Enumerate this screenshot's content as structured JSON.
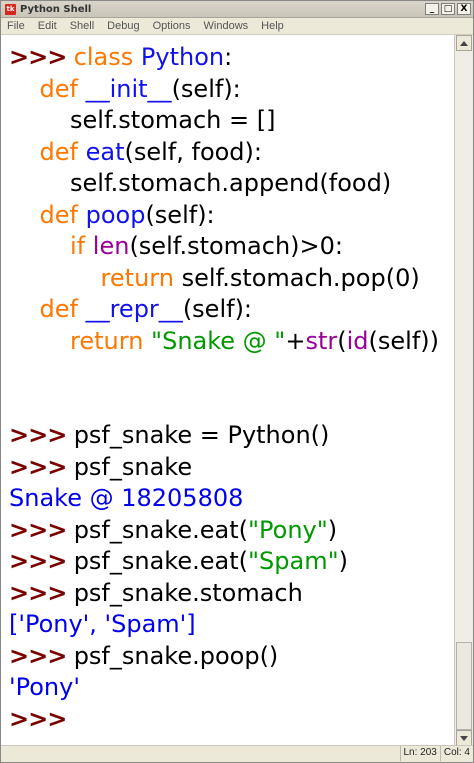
{
  "window": {
    "title": "Python Shell",
    "icon": "tk-feather-icon"
  },
  "menu": [
    "File",
    "Edit",
    "Shell",
    "Debug",
    "Options",
    "Windows",
    "Help"
  ],
  "controls": {
    "minimize": "_",
    "maximize": "□",
    "close": "X"
  },
  "colors": {
    "prompt": "#7a0000",
    "keyword": "#ff7700",
    "definition": "#1111ee",
    "builtin": "#990099",
    "string": "#009900",
    "output": "#0000ee"
  },
  "code": [
    [
      {
        "t": ">>> ",
        "c": "prompt"
      },
      {
        "t": "class ",
        "c": "kw"
      },
      {
        "t": "Python",
        "c": "fn"
      },
      {
        "t": ":",
        "c": "plain"
      }
    ],
    [
      {
        "t": "    ",
        "c": "plain"
      },
      {
        "t": "def ",
        "c": "kw"
      },
      {
        "t": "__init__",
        "c": "fn"
      },
      {
        "t": "(self):",
        "c": "plain"
      }
    ],
    [
      {
        "t": "        self.stomach = []",
        "c": "plain"
      }
    ],
    [
      {
        "t": "    ",
        "c": "plain"
      },
      {
        "t": "def ",
        "c": "kw"
      },
      {
        "t": "eat",
        "c": "fn"
      },
      {
        "t": "(self, food):",
        "c": "plain"
      }
    ],
    [
      {
        "t": "        self.stomach.append(food)",
        "c": "plain"
      }
    ],
    [
      {
        "t": "    ",
        "c": "plain"
      },
      {
        "t": "def ",
        "c": "kw"
      },
      {
        "t": "poop",
        "c": "fn"
      },
      {
        "t": "(self):",
        "c": "plain"
      }
    ],
    [
      {
        "t": "        ",
        "c": "plain"
      },
      {
        "t": "if ",
        "c": "kw"
      },
      {
        "t": "len",
        "c": "bi"
      },
      {
        "t": "(self.stomach)>0:",
        "c": "plain"
      }
    ],
    [
      {
        "t": "            ",
        "c": "plain"
      },
      {
        "t": "return ",
        "c": "kw"
      },
      {
        "t": "self.stomach.pop(0)",
        "c": "plain"
      }
    ],
    [
      {
        "t": "    ",
        "c": "plain"
      },
      {
        "t": "def ",
        "c": "kw"
      },
      {
        "t": "__repr__",
        "c": "fn"
      },
      {
        "t": "(self):",
        "c": "plain"
      }
    ],
    [
      {
        "t": "        ",
        "c": "plain"
      },
      {
        "t": "return ",
        "c": "kw"
      },
      {
        "t": "\"Snake @ \"",
        "c": "str"
      },
      {
        "t": "+",
        "c": "plain"
      },
      {
        "t": "str",
        "c": "bi"
      },
      {
        "t": "(",
        "c": "plain"
      },
      {
        "t": "id",
        "c": "bi"
      },
      {
        "t": "(self))",
        "c": "plain"
      }
    ],
    [],
    [],
    [
      {
        "t": ">>> ",
        "c": "prompt"
      },
      {
        "t": "psf_snake = Python()",
        "c": "plain"
      }
    ],
    [
      {
        "t": ">>> ",
        "c": "prompt"
      },
      {
        "t": "psf_snake",
        "c": "plain"
      }
    ],
    [
      {
        "t": "Snake @ 18205808",
        "c": "out"
      }
    ],
    [
      {
        "t": ">>> ",
        "c": "prompt"
      },
      {
        "t": "psf_snake.eat(",
        "c": "plain"
      },
      {
        "t": "\"Pony\"",
        "c": "str"
      },
      {
        "t": ")",
        "c": "plain"
      }
    ],
    [
      {
        "t": ">>> ",
        "c": "prompt"
      },
      {
        "t": "psf_snake.eat(",
        "c": "plain"
      },
      {
        "t": "\"Spam\"",
        "c": "str"
      },
      {
        "t": ")",
        "c": "plain"
      }
    ],
    [
      {
        "t": ">>> ",
        "c": "prompt"
      },
      {
        "t": "psf_snake.stomach",
        "c": "plain"
      }
    ],
    [
      {
        "t": "['Pony', 'Spam']",
        "c": "out"
      }
    ],
    [
      {
        "t": ">>> ",
        "c": "prompt"
      },
      {
        "t": "psf_snake.poop()",
        "c": "plain"
      }
    ],
    [
      {
        "t": "'Pony'",
        "c": "out"
      }
    ],
    [
      {
        "t": ">>> ",
        "c": "prompt"
      }
    ]
  ],
  "status": {
    "line": "Ln: 203",
    "col": "Col: 4"
  },
  "scroll": {
    "thumb_fraction": 0.13,
    "position": "bottom"
  }
}
